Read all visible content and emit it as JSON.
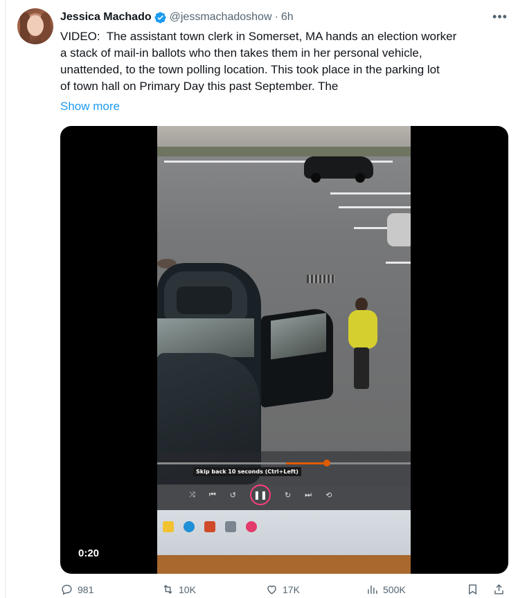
{
  "author": {
    "name": "Jessica Machado",
    "handle": "@jessmachadoshow",
    "separator": "·",
    "time": "6h"
  },
  "tweet": {
    "text": "VIDEO:  The assistant town clerk in Somerset, MA hands an election worker\na stack of mail-in ballots who then takes them in her personal vehicle,\nunattended, to the town polling location. This took place in the parking lot\nof town hall on Primary Day this past September. The",
    "show_more": "Show more"
  },
  "video": {
    "timestamp": "0:20",
    "player_tooltip": "Skip back 10 seconds (Ctrl+Left)"
  },
  "actions": {
    "replies": "981",
    "reposts": "10K",
    "likes": "17K",
    "views": "500K"
  },
  "icons": {
    "more": "more-options-icon",
    "verified": "verified-badge-icon",
    "reply": "reply-icon",
    "repost": "repost-icon",
    "like": "like-icon",
    "views": "views-icon",
    "bookmark": "bookmark-icon",
    "share": "share-icon"
  },
  "colors": {
    "accent": "#1d9bf0",
    "text": "#0f1419",
    "secondary": "#536471",
    "player_progress": "#e05a00"
  }
}
